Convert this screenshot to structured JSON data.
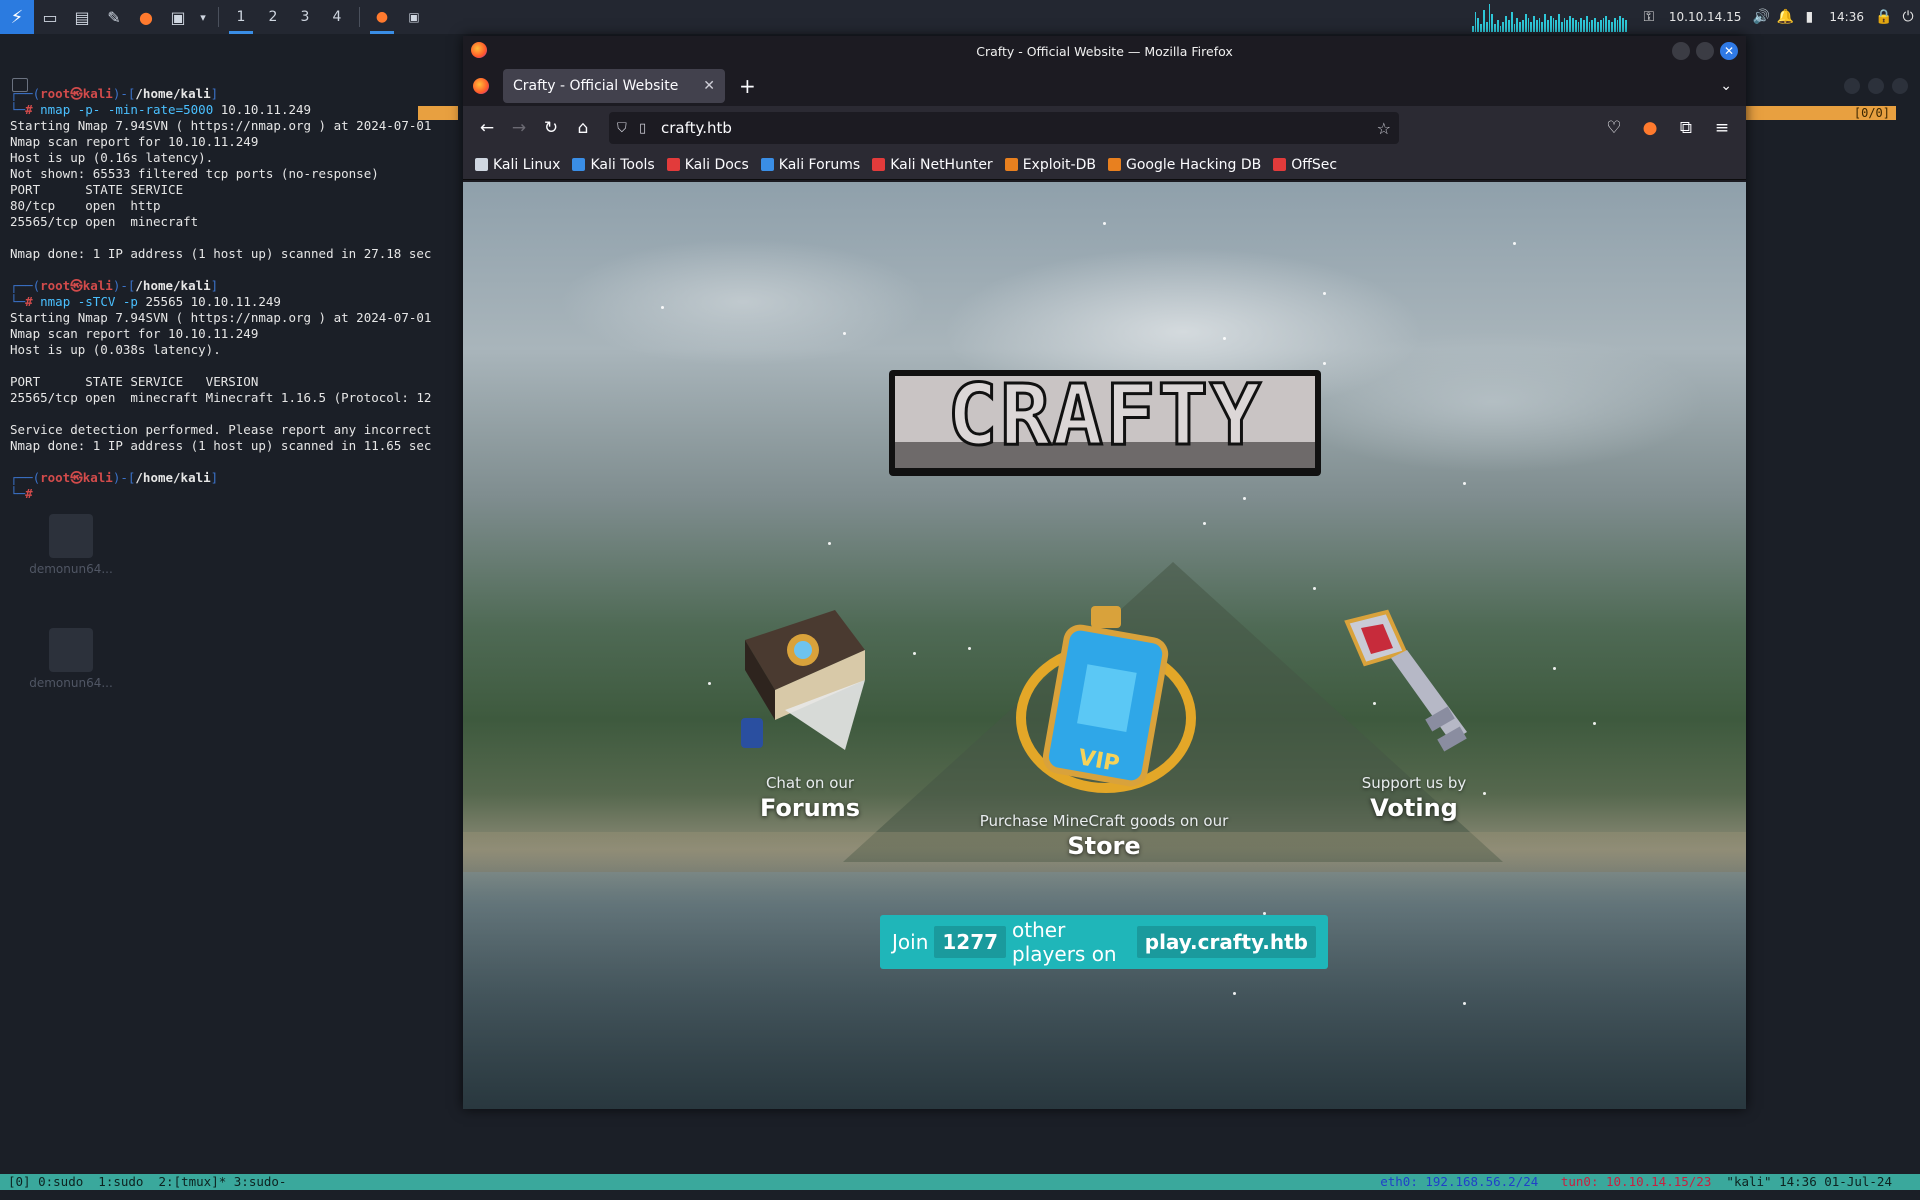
{
  "panel": {
    "workspaces": [
      "1",
      "2",
      "3",
      "4"
    ],
    "ip": "10.10.14.15",
    "clock": "14:36"
  },
  "terminal": {
    "lines": [
      {
        "kind": "prompt",
        "user": "root",
        "host": "kali",
        "path": "/home/kali"
      },
      {
        "kind": "cmd",
        "text": "nmap -p- -min-rate=5000",
        "arg": " 10.10.11.249"
      },
      {
        "kind": "out",
        "text": "Starting Nmap 7.94SVN ( https://nmap.org ) at 2024-07-01"
      },
      {
        "kind": "out",
        "text": "Nmap scan report for 10.10.11.249"
      },
      {
        "kind": "out",
        "text": "Host is up (0.16s latency)."
      },
      {
        "kind": "out",
        "text": "Not shown: 65533 filtered tcp ports (no-response)"
      },
      {
        "kind": "out",
        "text": "PORT      STATE SERVICE"
      },
      {
        "kind": "out",
        "text": "80/tcp    open  http"
      },
      {
        "kind": "out",
        "text": "25565/tcp open  minecraft"
      },
      {
        "kind": "out",
        "text": ""
      },
      {
        "kind": "out",
        "text": "Nmap done: 1 IP address (1 host up) scanned in 27.18 sec"
      },
      {
        "kind": "out",
        "text": ""
      },
      {
        "kind": "prompt",
        "user": "root",
        "host": "kali",
        "path": "/home/kali"
      },
      {
        "kind": "cmd",
        "text": "nmap -sTCV -p",
        "arg": " 25565 10.10.11.249"
      },
      {
        "kind": "out",
        "text": "Starting Nmap 7.94SVN ( https://nmap.org ) at 2024-07-01"
      },
      {
        "kind": "out",
        "text": "Nmap scan report for 10.10.11.249"
      },
      {
        "kind": "out",
        "text": "Host is up (0.038s latency)."
      },
      {
        "kind": "out",
        "text": ""
      },
      {
        "kind": "out",
        "text": "PORT      STATE SERVICE   VERSION"
      },
      {
        "kind": "out",
        "text": "25565/tcp open  minecraft Minecraft 1.16.5 (Protocol: 12"
      },
      {
        "kind": "out",
        "text": ""
      },
      {
        "kind": "out",
        "text": "Service detection performed. Please report any incorrect"
      },
      {
        "kind": "out",
        "text": "Nmap done: 1 IP address (1 host up) scanned in 11.65 sec"
      },
      {
        "kind": "out",
        "text": ""
      },
      {
        "kind": "prompt",
        "user": "root",
        "host": "kali",
        "path": "/home/kali"
      },
      {
        "kind": "cursor",
        "text": "#"
      }
    ],
    "tmux_right": "[0/0]",
    "desktop_icons": [
      "demonun64...",
      "demonun64..."
    ]
  },
  "tmux_bar": {
    "left": "[0] 0:sudo  1:sudo  2:[tmux]* 3:sudo-",
    "eth": "eth0: 192.168.56.2/24",
    "tun": "tun0: 10.10.14.15/23",
    "host_time": "\"kali\" 14:36 01-Jul-24"
  },
  "firefox": {
    "window_title": "Crafty - Official Website — Mozilla Firefox",
    "tab_title": "Crafty - Official Website",
    "url": "crafty.htb",
    "bookmarks": [
      {
        "label": "Kali Linux",
        "color": "#cfd6e0"
      },
      {
        "label": "Kali Tools",
        "color": "#3a8ee6"
      },
      {
        "label": "Kali Docs",
        "color": "#e23b3b"
      },
      {
        "label": "Kali Forums",
        "color": "#3a8ee6"
      },
      {
        "label": "Kali NetHunter",
        "color": "#e23b3b"
      },
      {
        "label": "Exploit-DB",
        "color": "#e8801f"
      },
      {
        "label": "Google Hacking DB",
        "color": "#e8801f"
      },
      {
        "label": "OffSec",
        "color": "#e23b3b"
      }
    ]
  },
  "page": {
    "logo_text": "CRAFTY",
    "forums": {
      "small": "Chat on our",
      "big": "Forums"
    },
    "store": {
      "small": "Purchase MineCraft goods on our",
      "big": "Store"
    },
    "voting": {
      "small": "Support us by",
      "big": "Voting"
    },
    "join": {
      "prefix": "Join",
      "count": "1277",
      "middle": "other players on",
      "host": "play.crafty.htb"
    },
    "accent": "#1fb6b9"
  }
}
